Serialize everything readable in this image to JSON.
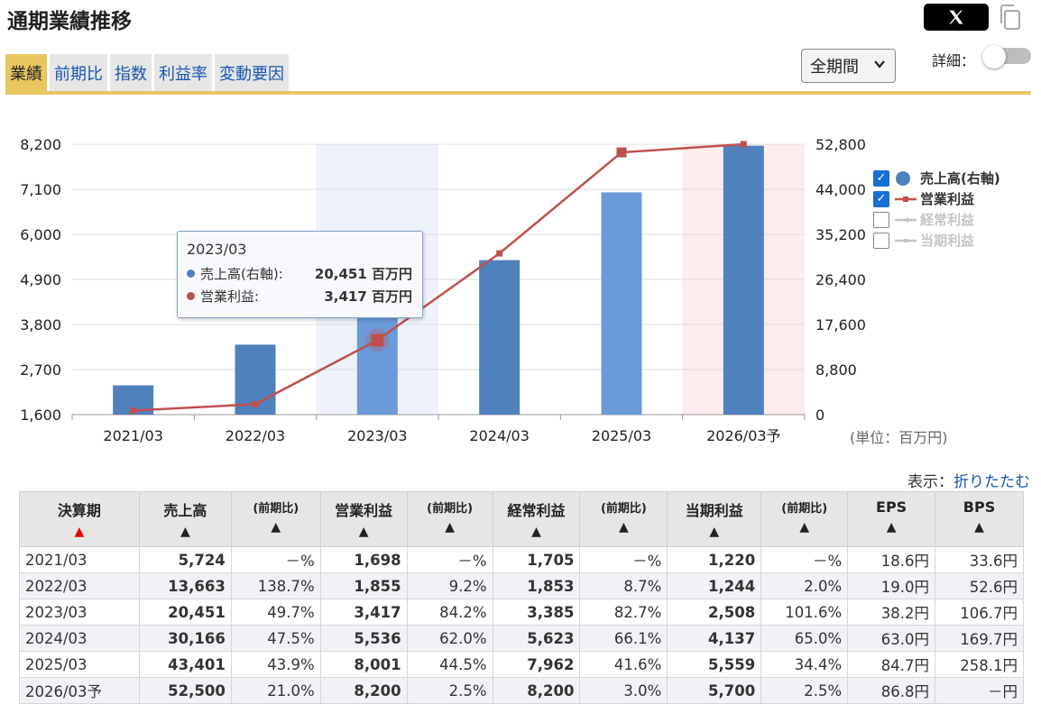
{
  "header": {
    "title": "通期業績推移",
    "share_icon": "x-logo-icon",
    "copy_icon": "copy-icon"
  },
  "tabs": [
    {
      "label": "業績",
      "active": true
    },
    {
      "label": "前期比",
      "active": false
    },
    {
      "label": "指数",
      "active": false
    },
    {
      "label": "利益率",
      "active": false
    },
    {
      "label": "変動要因",
      "active": false
    }
  ],
  "period_select": {
    "selected": "全期間"
  },
  "detail_toggle": {
    "label": "詳細：",
    "on": false
  },
  "colors": {
    "accent": "#e9c660",
    "bar": "#4f81bd",
    "bar_highlight": "#6a9bd8",
    "line": "#c0504d",
    "link": "#1a56b0"
  },
  "chart_data": {
    "type": "bar",
    "categories": [
      "2021/03",
      "2022/03",
      "2023/03",
      "2024/03",
      "2025/03",
      "2026/03予"
    ],
    "series": [
      {
        "name": "売上高(右軸)",
        "kind": "bar",
        "axis": "right",
        "values": [
          5724,
          13663,
          20451,
          30166,
          43401,
          52500
        ]
      },
      {
        "name": "営業利益",
        "kind": "line",
        "axis": "left",
        "values": [
          1698,
          1855,
          3417,
          5536,
          8001,
          8200
        ]
      }
    ],
    "y_left": {
      "ticks": [
        1600,
        2700,
        3800,
        4900,
        6000,
        7100,
        8200
      ],
      "range": [
        1600,
        8200
      ]
    },
    "y_right": {
      "ticks": [
        0,
        8800,
        17600,
        26400,
        35200,
        44000,
        52800
      ],
      "range": [
        0,
        52800
      ]
    },
    "highlighted_category": "2023/03",
    "forecast_category": "2026/03予",
    "grid": true,
    "legend": {
      "placement": "right",
      "items": [
        {
          "label": "売上高(右軸)",
          "checked": true,
          "marker": "circle"
        },
        {
          "label": "営業利益",
          "checked": true,
          "marker": "line"
        },
        {
          "label": "経常利益",
          "checked": false,
          "marker": "line"
        },
        {
          "label": "当期利益",
          "checked": false,
          "marker": "line"
        }
      ]
    },
    "tooltip": {
      "title": "2023/03",
      "rows": [
        {
          "label": "売上高(右軸):",
          "value": "20,451 百万円"
        },
        {
          "label": "営業利益:",
          "value": "3,417 百万円"
        }
      ]
    },
    "unit_note": "(単位：百万円)"
  },
  "table_toggle": {
    "prefix": "表示：",
    "link": "折りたたむ"
  },
  "table": {
    "headers": [
      {
        "label": "決算期",
        "sort": "▲",
        "active": true
      },
      {
        "label": "売上高",
        "sort": "▲"
      },
      {
        "label": "(前期比)",
        "sort": "▲"
      },
      {
        "label": "営業利益",
        "sort": "▲"
      },
      {
        "label": "(前期比)",
        "sort": "▲"
      },
      {
        "label": "経常利益",
        "sort": "▲"
      },
      {
        "label": "(前期比)",
        "sort": "▲"
      },
      {
        "label": "当期利益",
        "sort": "▲"
      },
      {
        "label": "(前期比)",
        "sort": "▲"
      },
      {
        "label": "EPS",
        "sort": "▲"
      },
      {
        "label": "BPS",
        "sort": "▲"
      }
    ],
    "rows": [
      [
        "2021/03",
        "5,724",
        "－%",
        "1,698",
        "－%",
        "1,705",
        "－%",
        "1,220",
        "－%",
        "18.6円",
        "33.6円"
      ],
      [
        "2022/03",
        "13,663",
        "138.7%",
        "1,855",
        "9.2%",
        "1,853",
        "8.7%",
        "1,244",
        "2.0%",
        "19.0円",
        "52.6円"
      ],
      [
        "2023/03",
        "20,451",
        "49.7%",
        "3,417",
        "84.2%",
        "3,385",
        "82.7%",
        "2,508",
        "101.6%",
        "38.2円",
        "106.7円"
      ],
      [
        "2024/03",
        "30,166",
        "47.5%",
        "5,536",
        "62.0%",
        "5,623",
        "66.1%",
        "4,137",
        "65.0%",
        "63.0円",
        "169.7円"
      ],
      [
        "2025/03",
        "43,401",
        "43.9%",
        "8,001",
        "44.5%",
        "7,962",
        "41.6%",
        "5,559",
        "34.4%",
        "84.7円",
        "258.1円"
      ],
      [
        "2026/03予",
        "52,500",
        "21.0%",
        "8,200",
        "2.5%",
        "8,200",
        "3.0%",
        "5,700",
        "2.5%",
        "86.8円",
        "－円"
      ]
    ]
  }
}
